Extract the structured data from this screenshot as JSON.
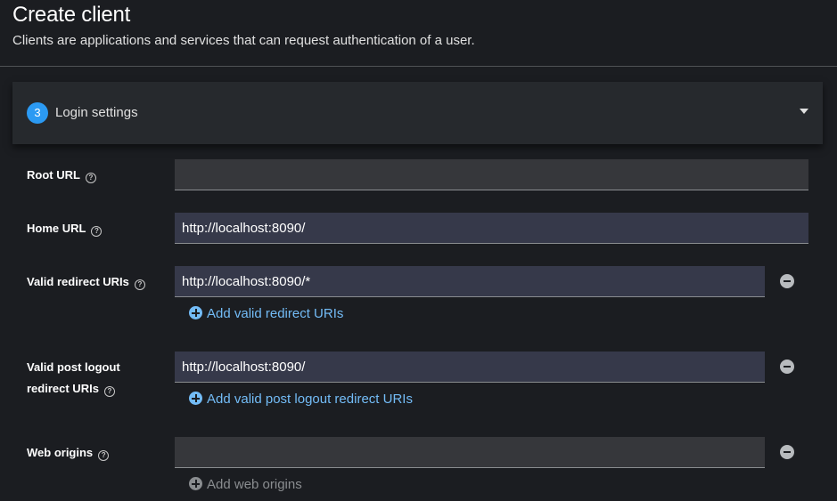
{
  "header": {
    "title": "Create client",
    "subtitle": "Clients are applications and services that can request authentication of a user."
  },
  "step": {
    "number": "3",
    "label": "Login settings",
    "toggle_icon": "caret-down-icon"
  },
  "fields": {
    "root_url": {
      "label": "Root URL",
      "value": ""
    },
    "home_url": {
      "label": "Home URL",
      "value": "http://localhost:8090/"
    },
    "valid_redirect_uris": {
      "label": "Valid redirect URIs",
      "value": "http://localhost:8090/*",
      "add_label": "Add valid redirect URIs"
    },
    "valid_post_logout": {
      "label_line1": "Valid post logout",
      "label_line2": "redirect URIs",
      "value": "http://localhost:8090/",
      "add_label": "Add valid post logout redirect URIs"
    },
    "web_origins": {
      "label": "Web origins",
      "value": "",
      "add_label": "Add web origins"
    }
  },
  "colors": {
    "background": "#1b1d21",
    "card": "#26292d",
    "accent": "#2b9af3",
    "link": "#73bcf7",
    "disabled": "#8a8d90"
  }
}
